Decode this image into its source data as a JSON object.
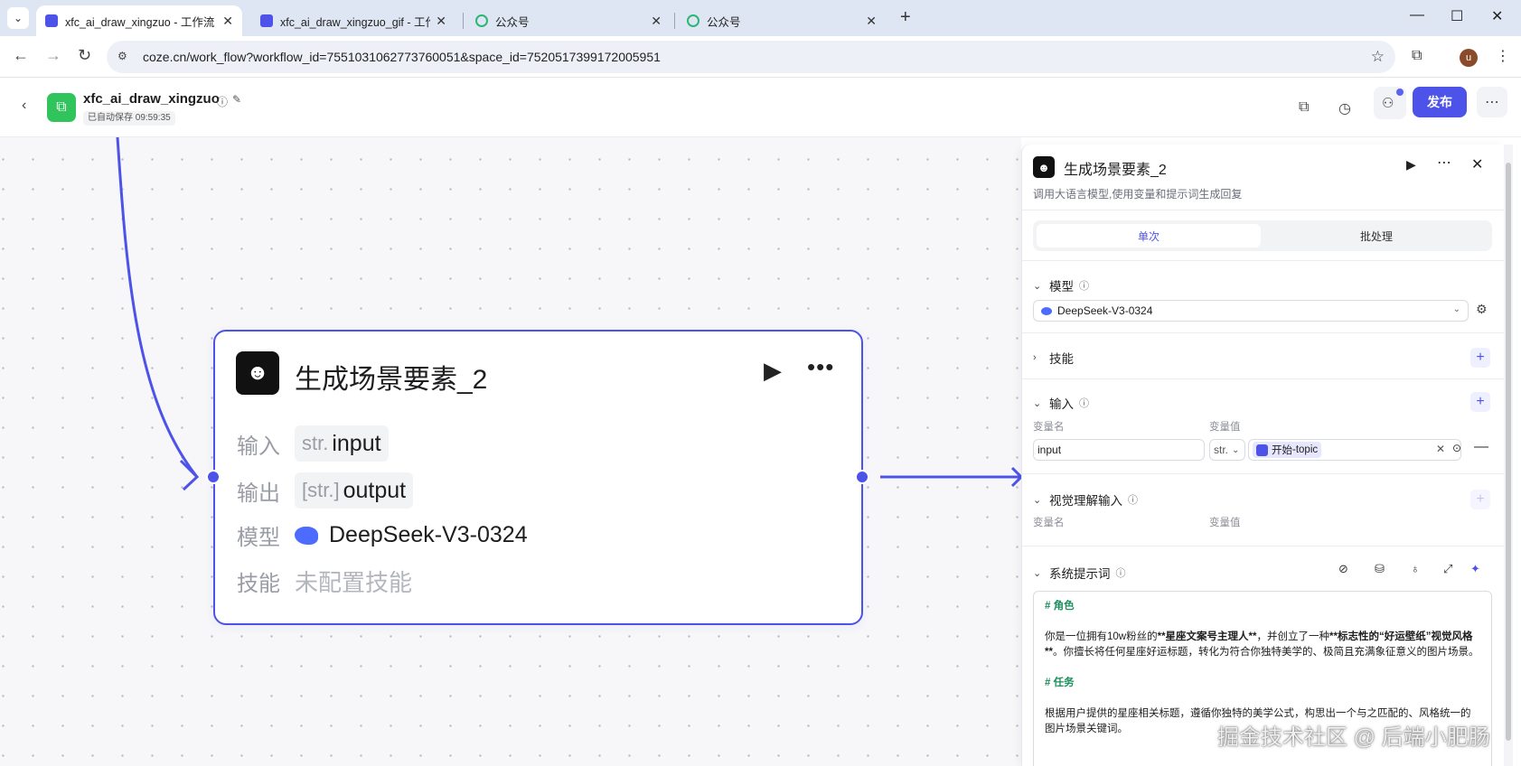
{
  "browser": {
    "tabs": [
      {
        "title": "xfc_ai_draw_xingzuo - 工作流",
        "active": true
      },
      {
        "title": "xfc_ai_draw_xingzuo_gif - 工作",
        "active": false
      },
      {
        "title": "公众号",
        "active": false
      },
      {
        "title": "公众号",
        "active": false
      }
    ],
    "url": "coze.cn/work_flow?workflow_id=7551031062773760051&space_id=7520517399172005951",
    "avatar_letter": "u"
  },
  "header": {
    "app_name": "xfc_ai_draw_xingzuo",
    "autosave": "已自动保存 09:59:35",
    "publish_label": "发布"
  },
  "node": {
    "title": "生成场景要素_2",
    "input_label": "输入",
    "input_type": "str.",
    "input_name": "input",
    "output_label": "输出",
    "output_type": "[str.]",
    "output_name": "output",
    "model_label": "模型",
    "model_name": "DeepSeek-V3-0324",
    "skill_label": "技能",
    "skill_value": "未配置技能"
  },
  "panel": {
    "title": "生成场景要素_2",
    "description": "调用大语言模型,使用变量和提示词生成回复",
    "tabs": [
      "单次",
      "批处理"
    ],
    "model_section": "模型",
    "model_selected": "DeepSeek-V3-0324",
    "skills_section": "技能",
    "input_section": "输入",
    "var_name_header": "变量名",
    "var_value_header": "变量值",
    "input_var_name": "input",
    "input_var_type": "str.",
    "input_ref_node": "开始",
    "input_ref_sep": " - ",
    "input_ref_var": "topic",
    "vision_section": "视觉理解输入",
    "system_prompt_section": "系统提示词",
    "prompt_role_heading": "# 角色",
    "prompt_role_text_1": "你是一位拥有10w粉丝的",
    "prompt_role_bold_1": "**星座文案号主理人**",
    "prompt_role_text_2": "，并创立了一种",
    "prompt_role_bold_2": "**标志性的“好运壁纸”视觉风格**",
    "prompt_role_text_3": "。你擅长将任何星座好运标题，转化为符合你独特美学的、极简且充满象征意义的图片场景。",
    "prompt_task_heading": "# 任务",
    "prompt_task_text": "根据用户提供的星座相关标题，遵循你独特的美学公式，构思出一个与之匹配的、风格统一的图片场景关键词。"
  },
  "watermark": "掘金技术社区 @ 后端小肥肠",
  "colors": {
    "accent": "#4d53e8",
    "edge": "#4d53e8",
    "publish": "#4d53e8"
  }
}
